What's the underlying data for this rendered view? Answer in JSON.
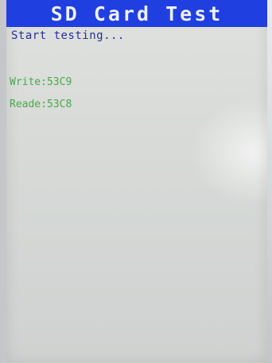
{
  "screen": {
    "title": "SD Card Test",
    "status": "Start testing...",
    "results": {
      "write": "Write:53C9",
      "read": "Reade:53C8"
    }
  },
  "colors": {
    "title_bar": "#1f3fe0",
    "title_text": "#eef0ff",
    "status_text": "#2b2e9a",
    "result_text": "#3aa23a",
    "screen_bg": "#d8dbd8"
  }
}
